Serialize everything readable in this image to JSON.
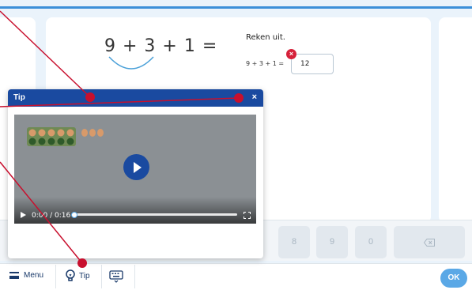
{
  "exercise": {
    "big_expression": "9 + 3 + 1 =",
    "instruction": "Reken uit.",
    "small_expression": "9 + 3 + 1 =",
    "answer_value": "12",
    "error_badge": "×"
  },
  "keypad": {
    "keys": [
      "8",
      "9",
      "0"
    ],
    "backspace_label": "⌫"
  },
  "bottom_bar": {
    "menu_label": "Menu",
    "tip_label": "Tip",
    "ok_label": "OK"
  },
  "dialog": {
    "title": "Tip",
    "close_label": "×",
    "video": {
      "time_display": "0:00 / 0:16",
      "progress": 0
    }
  },
  "colors": {
    "accent_blue": "#3b8fd9",
    "dialog_header": "#1a4aa0",
    "error_red": "#d6213a",
    "pointer_red": "#c8102e",
    "ok_button": "#5aa8e6"
  },
  "icons": [
    "menu-icon",
    "lightbulb-icon",
    "keyboard-icon",
    "play-icon",
    "fullscreen-icon",
    "close-icon",
    "backspace-icon"
  ]
}
